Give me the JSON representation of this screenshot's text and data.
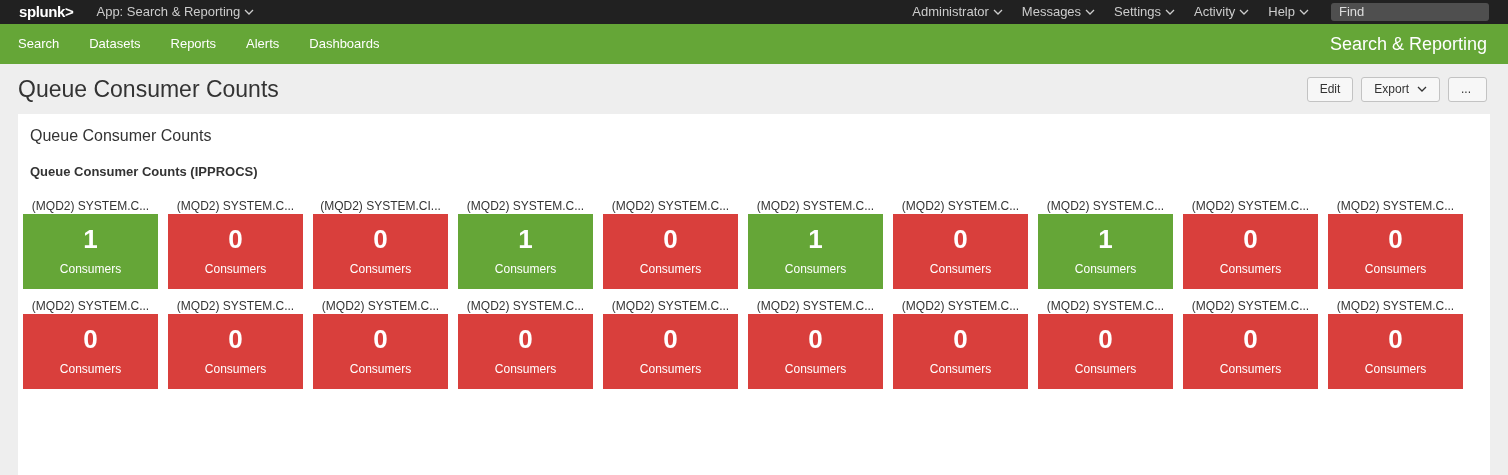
{
  "top_bar": {
    "logo": "splunk>",
    "app_menu": "App: Search & Reporting",
    "menus": [
      "Administrator",
      "Messages",
      "Settings",
      "Activity",
      "Help"
    ],
    "find": {
      "placeholder": "Find"
    }
  },
  "nav": {
    "items": [
      "Search",
      "Datasets",
      "Reports",
      "Alerts",
      "Dashboards"
    ],
    "app_title": "Search & Reporting"
  },
  "page": {
    "title": "Queue Consumer Counts",
    "buttons": [
      {
        "label": "Edit",
        "kind": "plain"
      },
      {
        "label": "Export",
        "kind": "dropdown"
      },
      {
        "label": "...",
        "kind": "plain"
      }
    ]
  },
  "panel": {
    "title": "Queue Consumer Counts",
    "subtitle": "Queue Consumer Counts (IPPROCS)",
    "tiles": [
      {
        "title": "(MQD2) SYSTEM.C...",
        "value": "1",
        "unit": "Consumers",
        "color": "#65a637"
      },
      {
        "title": "(MQD2) SYSTEM.C...",
        "value": "0",
        "unit": "Consumers",
        "color": "#d93f3c"
      },
      {
        "title": "(MQD2) SYSTEM.CI...",
        "value": "0",
        "unit": "Consumers",
        "color": "#d93f3c"
      },
      {
        "title": "(MQD2) SYSTEM.C...",
        "value": "1",
        "unit": "Consumers",
        "color": "#65a637"
      },
      {
        "title": "(MQD2) SYSTEM.C...",
        "value": "0",
        "unit": "Consumers",
        "color": "#d93f3c"
      },
      {
        "title": "(MQD2) SYSTEM.C...",
        "value": "1",
        "unit": "Consumers",
        "color": "#65a637"
      },
      {
        "title": "(MQD2) SYSTEM.C...",
        "value": "0",
        "unit": "Consumers",
        "color": "#d93f3c"
      },
      {
        "title": "(MQD2) SYSTEM.C...",
        "value": "1",
        "unit": "Consumers",
        "color": "#65a637"
      },
      {
        "title": "(MQD2) SYSTEM.C...",
        "value": "0",
        "unit": "Consumers",
        "color": "#d93f3c"
      },
      {
        "title": "(MQD2) SYSTEM.C...",
        "value": "0",
        "unit": "Consumers",
        "color": "#d93f3c"
      },
      {
        "title": "(MQD2) SYSTEM.C...",
        "value": "0",
        "unit": "Consumers",
        "color": "#d93f3c"
      },
      {
        "title": "(MQD2) SYSTEM.C...",
        "value": "0",
        "unit": "Consumers",
        "color": "#d93f3c"
      },
      {
        "title": "(MQD2) SYSTEM.C...",
        "value": "0",
        "unit": "Consumers",
        "color": "#d93f3c"
      },
      {
        "title": "(MQD2) SYSTEM.C...",
        "value": "0",
        "unit": "Consumers",
        "color": "#d93f3c"
      },
      {
        "title": "(MQD2) SYSTEM.C...",
        "value": "0",
        "unit": "Consumers",
        "color": "#d93f3c"
      },
      {
        "title": "(MQD2) SYSTEM.C...",
        "value": "0",
        "unit": "Consumers",
        "color": "#d93f3c"
      },
      {
        "title": "(MQD2) SYSTEM.C...",
        "value": "0",
        "unit": "Consumers",
        "color": "#d93f3c"
      },
      {
        "title": "(MQD2) SYSTEM.C...",
        "value": "0",
        "unit": "Consumers",
        "color": "#d93f3c"
      },
      {
        "title": "(MQD2) SYSTEM.C...",
        "value": "0",
        "unit": "Consumers",
        "color": "#d93f3c"
      },
      {
        "title": "(MQD2) SYSTEM.C...",
        "value": "0",
        "unit": "Consumers",
        "color": "#d93f3c"
      }
    ]
  }
}
